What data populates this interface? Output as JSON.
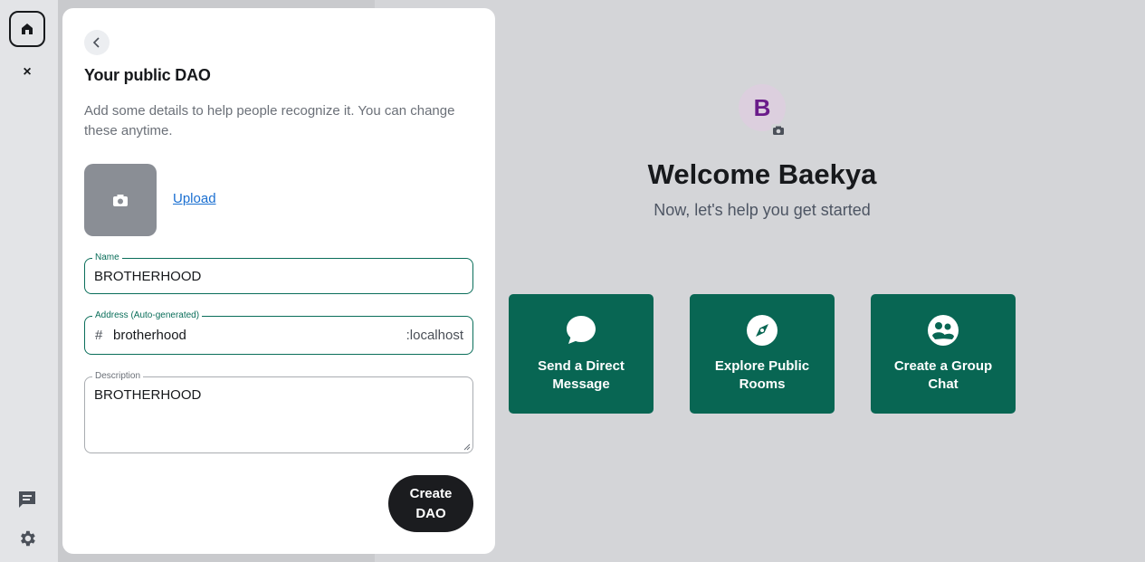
{
  "dialog": {
    "title": "Your public DAO",
    "description": "Add some details to help people recognize it. You can change these anytime.",
    "upload_label": "Upload",
    "name_field": {
      "label": "Name",
      "value": "BROTHERHOOD"
    },
    "address_field": {
      "label": "Address (Auto-generated)",
      "prefix": "#",
      "value": "brotherhood",
      "suffix": ":localhost"
    },
    "description_field": {
      "label": "Description",
      "value": "BROTHERHOOD"
    },
    "create_button": "Create DAO"
  },
  "welcome": {
    "avatar_letter": "B",
    "title": "Welcome Baekya",
    "subtitle": "Now, let's help you get started",
    "tiles": [
      {
        "label": "Send a Direct Message",
        "icon": "chat-bubble-icon"
      },
      {
        "label": "Explore Public Rooms",
        "icon": "compass-icon"
      },
      {
        "label": "Create a Group Chat",
        "icon": "group-icon"
      }
    ]
  },
  "rail": {
    "close_glyph": "×"
  },
  "colors": {
    "accent": "#0a6e5a",
    "tile": "#086653",
    "link": "#1a6fd1",
    "avatar_letter": "#6a1b8a"
  }
}
